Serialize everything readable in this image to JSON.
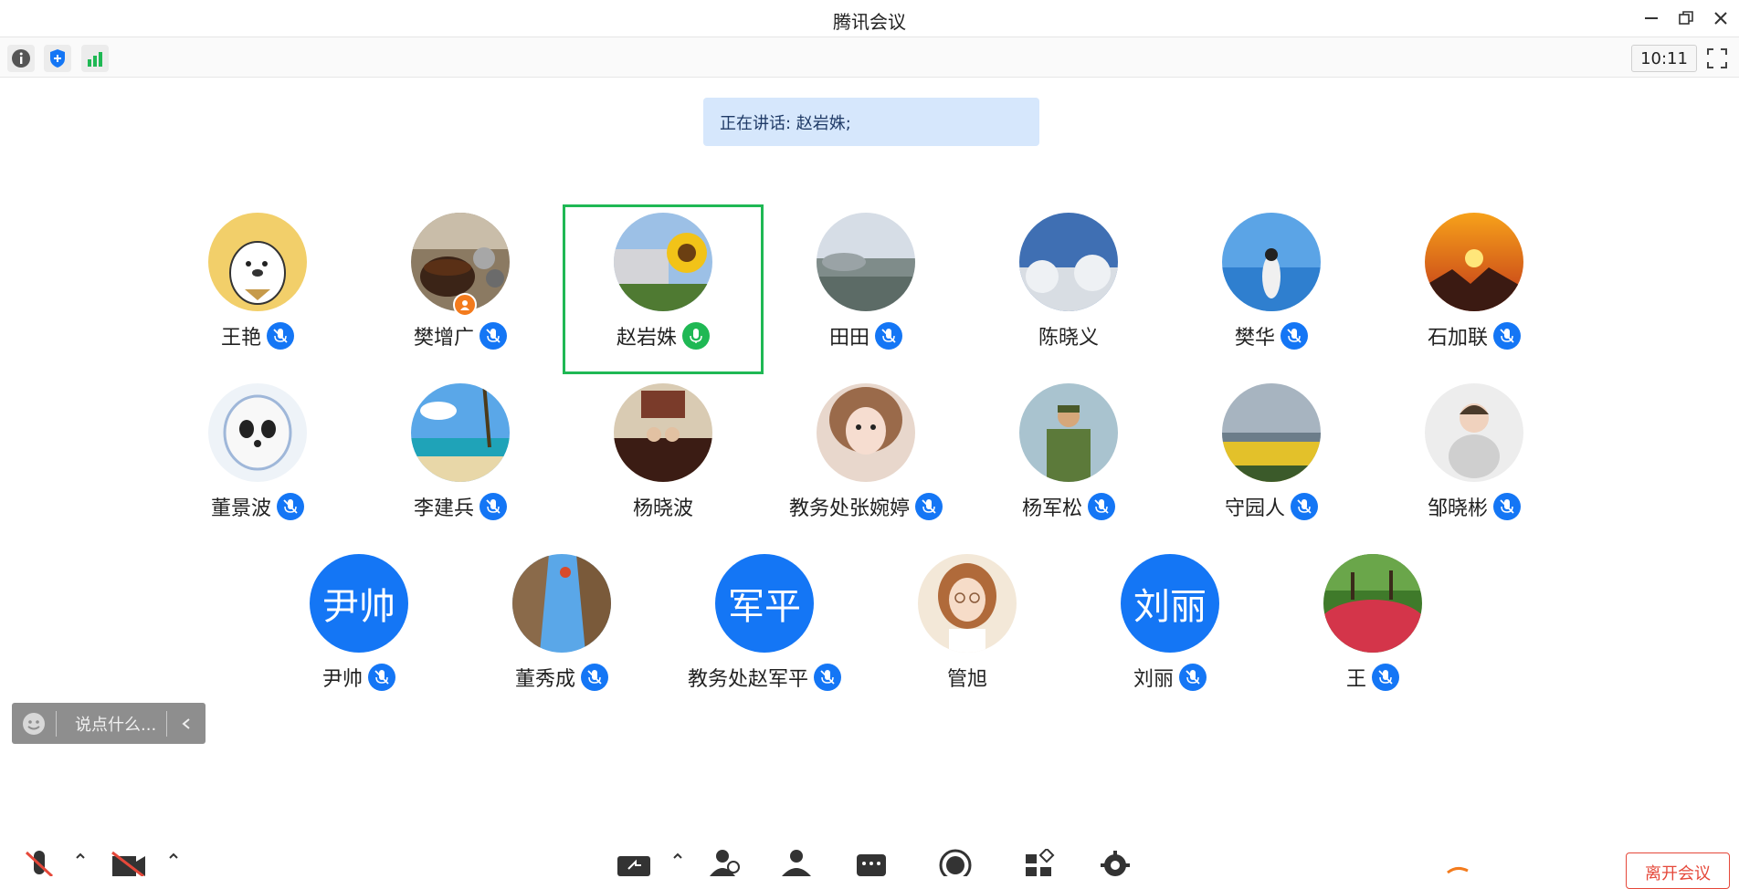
{
  "window": {
    "title": "腾讯会议"
  },
  "infobar": {
    "time": "10:11"
  },
  "speaking": {
    "text": "正在讲话: 赵岩姝;"
  },
  "participants": [
    {
      "name": "王艳",
      "mic": "muted"
    },
    {
      "name": "樊增广",
      "mic": "muted",
      "host": true
    },
    {
      "name": "赵岩姝",
      "mic": "speaking",
      "active": true
    },
    {
      "name": "田田",
      "mic": "muted"
    },
    {
      "name": "陈晓义",
      "mic": "none"
    },
    {
      "name": "樊华",
      "mic": "muted"
    },
    {
      "name": "石加联",
      "mic": "muted"
    },
    {
      "name": "董景波",
      "mic": "muted"
    },
    {
      "name": "李建兵",
      "mic": "muted"
    },
    {
      "name": "杨晓波",
      "mic": "none"
    },
    {
      "name": "教务处张婉婷",
      "mic": "muted"
    },
    {
      "name": "杨军松",
      "mic": "muted"
    },
    {
      "name": "守园人",
      "mic": "muted"
    },
    {
      "name": "邹晓彬",
      "mic": "muted"
    },
    {
      "name": "尹帅",
      "mic": "muted",
      "avatar_text": "尹帅"
    },
    {
      "name": "董秀成",
      "mic": "muted"
    },
    {
      "name": "教务处赵军平",
      "mic": "muted",
      "avatar_text": "军平"
    },
    {
      "name": "管旭",
      "mic": "none"
    },
    {
      "name": "刘丽",
      "mic": "muted",
      "avatar_text": "刘丽"
    },
    {
      "name": "王",
      "mic": "muted"
    }
  ],
  "chat": {
    "placeholder": "说点什么..."
  },
  "toolbar": {
    "leave_label": "离开会议"
  },
  "colors": {
    "accent": "#1476f5",
    "speaking": "#1fb854",
    "danger": "#e5483a",
    "banner": "#d6e7fc"
  }
}
